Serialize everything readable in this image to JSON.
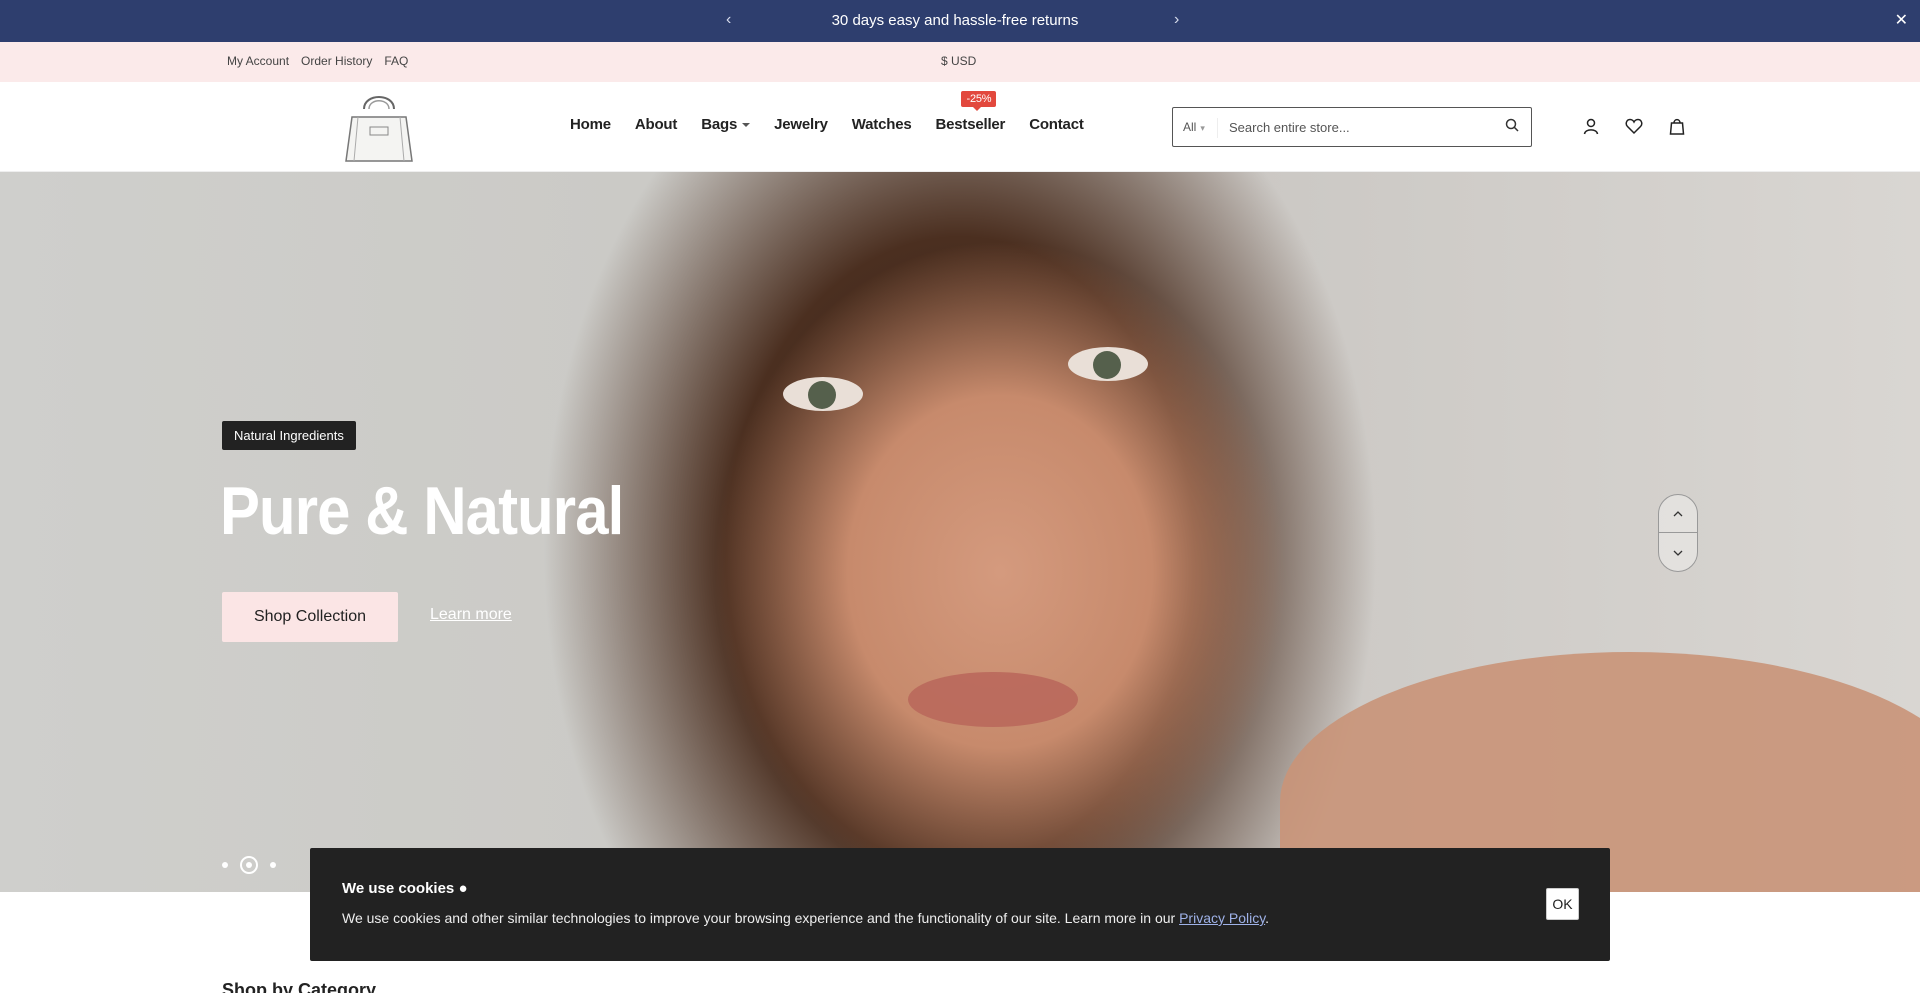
{
  "announcement": {
    "message": "30 days easy and hassle-free returns",
    "prev_icon": "chevron-left-icon",
    "next_icon": "chevron-right-icon",
    "close_icon": "close-icon"
  },
  "topbar": {
    "links": [
      "My Account",
      "Order History",
      "FAQ"
    ],
    "currency": "$ USD"
  },
  "header": {
    "logo": "handbag-logo",
    "nav": [
      {
        "label": "Home"
      },
      {
        "label": "About"
      },
      {
        "label": "Bags",
        "dropdown": true
      },
      {
        "label": "Jewelry"
      },
      {
        "label": "Watches"
      },
      {
        "label": "Bestseller",
        "badge": "-25%"
      },
      {
        "label": "Contact"
      }
    ],
    "search": {
      "category": "All",
      "placeholder": "Search entire store..."
    },
    "icons": [
      "user-icon",
      "heart-icon",
      "cart-icon"
    ]
  },
  "hero": {
    "tag": "Natural Ingredients",
    "headline": "Pure & Natural",
    "primary_button": "Shop Collection",
    "secondary_link": "Learn more",
    "slides": 3,
    "active_slide": 2
  },
  "section": {
    "title": "Shop by Category"
  },
  "cookie": {
    "title": "We use cookies",
    "text": "We use cookies and other similar technologies to improve your browsing experience and the functionality of our site. Learn more in our ",
    "link": "Privacy Policy",
    "ok": "OK"
  },
  "colors": {
    "announcement_bg": "#2e3e6e",
    "topbar_bg": "#fbeaea",
    "sale_badge": "#e2483d",
    "cookie_bg": "#222222"
  }
}
